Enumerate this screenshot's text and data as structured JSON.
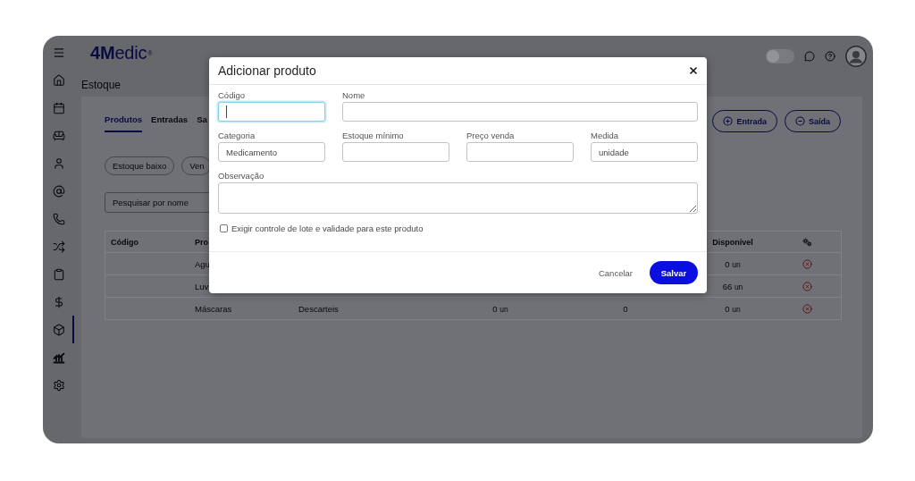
{
  "app": {
    "logo": "**4M**edic$^{®}$",
    "toggle": {
      "on": false
    }
  },
  "sidebar": {
    "items": [
      {
        "selected": false
      },
      {
        "selected": false
      },
      {
        "selected": false
      },
      {
        "selected": false
      },
      {
        "selected": false
      },
      {
        "selected": false
      },
      {
        "selected": false
      },
      {
        "selected": false
      },
      {
        "selected": false
      },
      {
        "selected": true
      },
      {
        "selected": false
      },
      {
        "selected": false
      }
    ]
  },
  "page": {
    "title": "Estoque",
    "tabs": [
      {
        "label": "Produtos",
        "selected": true
      },
      {
        "label": "Entradas",
        "selected": false
      },
      {
        "label": "Sa",
        "selected": false
      }
    ],
    "actions": [
      {
        "label": "Entrada",
        "kind": "add"
      },
      {
        "label": "Saída",
        "kind": "remove"
      }
    ],
    "filters": [
      {
        "label": "Estoque baixo",
        "selected": false
      },
      {
        "label": "Ven",
        "selected": false
      }
    ],
    "search": {
      "placeholder": "Pesquisar por nome"
    },
    "table": {
      "columns": [
        {
          "label": "Código"
        },
        {
          "label": "Pro"
        },
        {
          "label": "Disponível"
        },
        {
          "kind": "icon"
        }
      ],
      "rows": [
        {
          "column_2": "Agu",
          "available": {
            "value": "0",
            "unit": "un"
          }
        },
        {
          "column_2": "Luv",
          "available": {
            "value": "66",
            "unit": "un"
          }
        },
        {
          "column_2": "Máscaras",
          "column_3": "Descarteis",
          "column_4": {
            "value": "0",
            "unit": "un"
          },
          "column_5": "0",
          "available": {
            "value": "0",
            "unit": "un"
          }
        }
      ]
    }
  },
  "dialog": {
    "title": "Adicionar produto",
    "fields": [
      {
        "label": "Código",
        "kind": "input",
        "focused": true
      },
      {
        "label": "Nome",
        "kind": "input",
        "focused": false
      },
      {
        "label": "Categoria",
        "kind": "input",
        "value": "Medicamento",
        "focused": false
      },
      {
        "label": "Estoque mínimo",
        "kind": "input",
        "focused": false
      },
      {
        "label": "Preço venda",
        "kind": "input",
        "focused": false
      },
      {
        "label": "Medida",
        "kind": "input",
        "value": "unidade",
        "focused": false
      },
      {
        "label": "Observação",
        "kind": "textarea",
        "focused": false
      }
    ],
    "checkbox": {
      "label": "Exigir controle de lote e validade para este produto",
      "checked": false
    },
    "buttons": [
      {
        "label": "Cancelar",
        "kind": "text"
      },
      {
        "label": "Salvar",
        "kind": "primary"
      }
    ]
  }
}
